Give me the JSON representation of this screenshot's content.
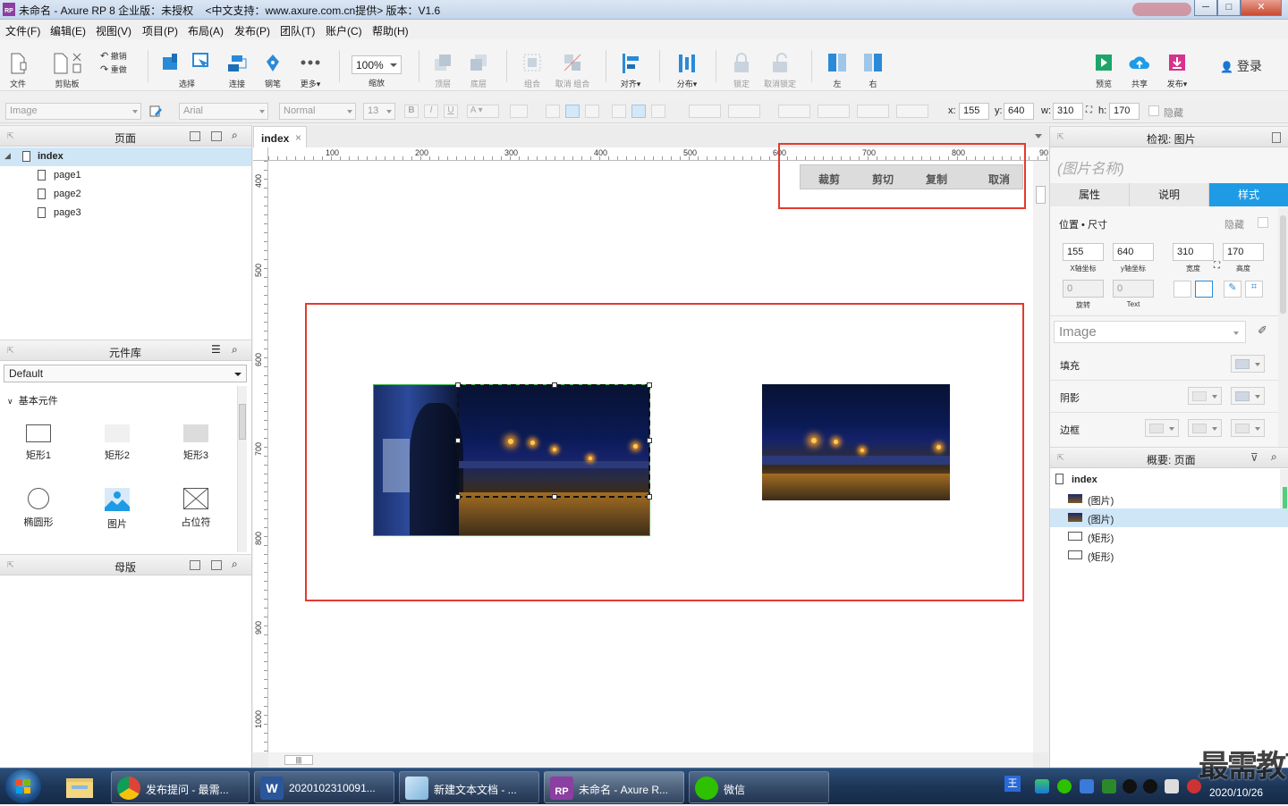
{
  "window": {
    "title": "未命名 - Axure RP 8 企业版：未授权",
    "support": "<中文支持：www.axure.com.cn提供> 版本：V1.6",
    "min": "─",
    "max": "□",
    "close": "✕"
  },
  "menu": [
    "文件(F)",
    "编辑(E)",
    "视图(V)",
    "项目(P)",
    "布局(A)",
    "发布(P)",
    "团队(T)",
    "账户(C)",
    "帮助(H)"
  ],
  "toolbar": {
    "file": "文件",
    "clipboard": "剪贴板",
    "undo": "撤销",
    "redo": "重做",
    "select": "选择",
    "connect": "连接",
    "pen": "钢笔",
    "more": "更多▾",
    "zoom_value": "100%",
    "zoom": "缩放",
    "top": "顶层",
    "bottom": "底层",
    "group": "组合",
    "ungroup": "取消 组合",
    "align": "对齐▾",
    "distribute": "分布▾",
    "lock": "锁定",
    "unlock": "取消锁定",
    "left": "左",
    "right": "右",
    "preview": "预览",
    "share": "共享",
    "publish": "发布▾",
    "login": "登录"
  },
  "format": {
    "style": "Image",
    "font": "Arial",
    "weight": "Normal",
    "size": "13",
    "x_label": "x:",
    "x": "155",
    "y_label": "y:",
    "y": "640",
    "w_label": "w:",
    "w": "310",
    "h_label": "h:",
    "h": "170",
    "hidden": "隐藏"
  },
  "pages_panel": {
    "title": "页面",
    "root": "index",
    "pages": [
      "page1",
      "page2",
      "page3"
    ]
  },
  "library_panel": {
    "title": "元件库",
    "selected": "Default",
    "group": "基本元件",
    "widgets": [
      "矩形1",
      "矩形2",
      "矩形3",
      "椭圆形",
      "图片",
      "占位符"
    ]
  },
  "masters_panel": {
    "title": "母版"
  },
  "canvas": {
    "tab": "index",
    "tab_close": "×",
    "ruler_h": [
      "100",
      "200",
      "300",
      "400",
      "500",
      "600",
      "700",
      "800",
      "90"
    ],
    "ruler_v": [
      "400",
      "500",
      "600",
      "700",
      "800",
      "900",
      "1000"
    ],
    "crop_actions": [
      "裁剪",
      "剪切",
      "复制",
      "取消"
    ],
    "hscroll": "|||"
  },
  "inspector": {
    "title": "检视: 图片",
    "name_placeholder": "(图片名称)",
    "tabs": [
      "属性",
      "说明",
      "样式"
    ],
    "section": "位置 • 尺寸",
    "hidden": "隐藏",
    "x": "155",
    "y": "640",
    "w": "310",
    "h": "170",
    "x_cap": "X轴坐标",
    "y_cap": "y轴坐标",
    "w_cap": "宽度",
    "h_cap": "高度",
    "rotate": "0",
    "rotate_cap": "旋转",
    "text_rot": "0",
    "text_cap": "Text",
    "style_name": "Image",
    "fill": "填充",
    "shadow": "阴影",
    "border": "边框"
  },
  "outline": {
    "title": "概要: 页面",
    "root": "index",
    "items": [
      "(图片)",
      "(图片)",
      "(矩形)",
      "(矩形)"
    ]
  },
  "taskbar": {
    "items": [
      "发布提问 - 最需...",
      "2020102310091...",
      "新建文本文档 - ...",
      "未命名 - Axure R...",
      "微信"
    ],
    "date": "2020/10/26",
    "watermark": "最需教育"
  }
}
